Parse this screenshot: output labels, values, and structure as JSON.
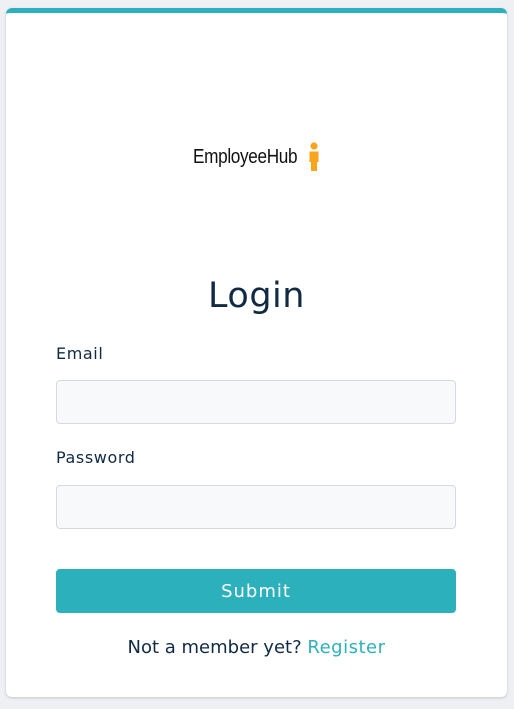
{
  "brand": {
    "name": "EmployeeHub",
    "icon": "person-icon",
    "icon_color": "#f8a51c"
  },
  "form": {
    "title": "Login",
    "email_label": "Email",
    "email_value": "",
    "password_label": "Password",
    "password_value": "",
    "submit_label": "Submit"
  },
  "footer": {
    "prompt": "Not a member yet?",
    "link_label": "Register"
  },
  "colors": {
    "accent": "#2cb1bc",
    "text": "#102a43",
    "input_background": "#f8f9fb"
  }
}
